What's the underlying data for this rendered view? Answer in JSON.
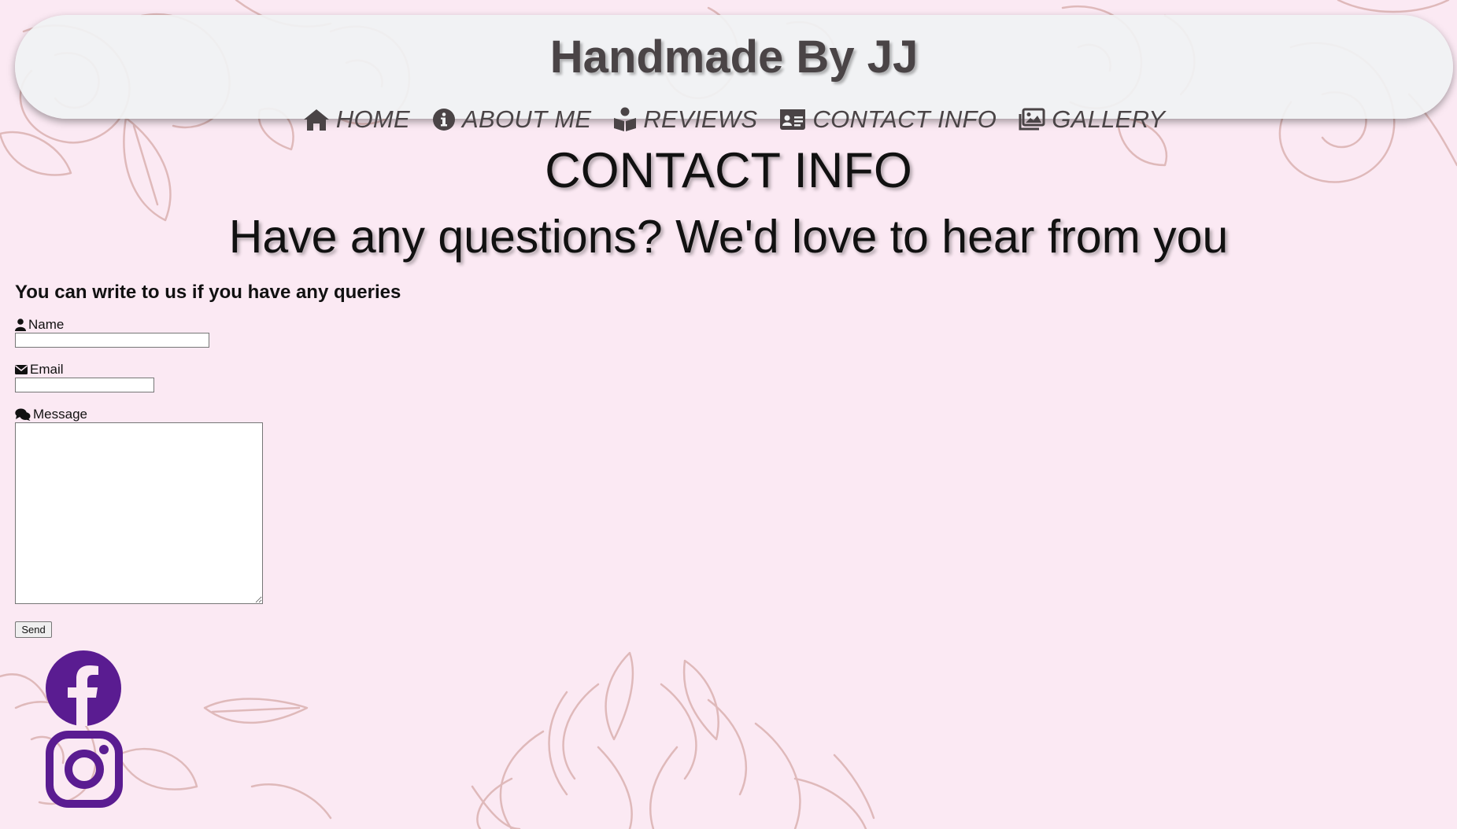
{
  "header": {
    "title": "Handmade By JJ"
  },
  "nav": {
    "items": [
      {
        "label": "HOME",
        "icon": "home-icon"
      },
      {
        "label": "ABOUT ME",
        "icon": "info-circle-icon"
      },
      {
        "label": "REVIEWS",
        "icon": "book-reader-icon"
      },
      {
        "label": "CONTACT INFO",
        "icon": "id-card-icon"
      },
      {
        "label": "GALLERY",
        "icon": "images-icon"
      }
    ]
  },
  "main": {
    "heading": "CONTACT INFO",
    "subheading": "Have any questions? We'd love to hear from you"
  },
  "form": {
    "intro": "You can write to us if you have any queries",
    "name_label": "Name",
    "name_value": "",
    "email_label": "Email",
    "email_value": "",
    "message_label": "Message",
    "message_value": "",
    "send_label": "Send"
  },
  "social": {
    "facebook_icon": "facebook-icon",
    "instagram_icon": "instagram-icon",
    "color": "#5a1c91"
  },
  "colors": {
    "background": "#fbe9f3",
    "header_bg": "#f0f2f3",
    "nav_text": "#4a4446",
    "floral_line": "#d9b0b0"
  }
}
